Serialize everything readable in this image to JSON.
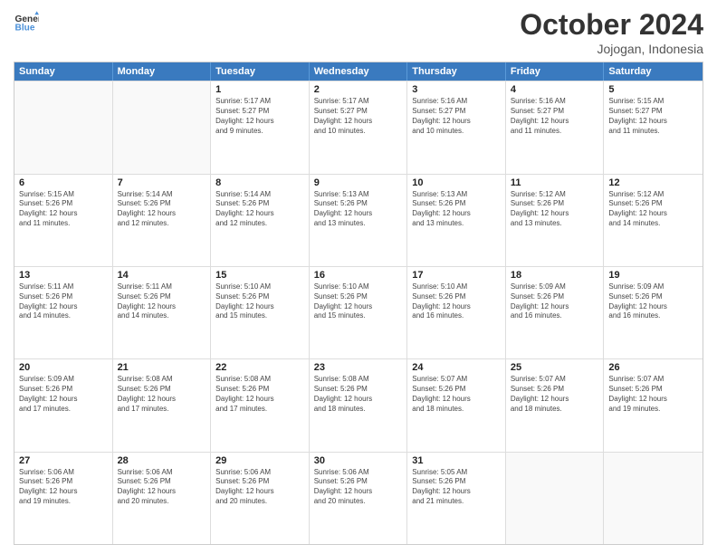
{
  "header": {
    "logo_line1": "General",
    "logo_line2": "Blue",
    "month": "October 2024",
    "location": "Jojogan, Indonesia"
  },
  "weekdays": [
    "Sunday",
    "Monday",
    "Tuesday",
    "Wednesday",
    "Thursday",
    "Friday",
    "Saturday"
  ],
  "rows": [
    [
      {
        "day": "",
        "info": ""
      },
      {
        "day": "",
        "info": ""
      },
      {
        "day": "1",
        "info": "Sunrise: 5:17 AM\nSunset: 5:27 PM\nDaylight: 12 hours\nand 9 minutes."
      },
      {
        "day": "2",
        "info": "Sunrise: 5:17 AM\nSunset: 5:27 PM\nDaylight: 12 hours\nand 10 minutes."
      },
      {
        "day": "3",
        "info": "Sunrise: 5:16 AM\nSunset: 5:27 PM\nDaylight: 12 hours\nand 10 minutes."
      },
      {
        "day": "4",
        "info": "Sunrise: 5:16 AM\nSunset: 5:27 PM\nDaylight: 12 hours\nand 11 minutes."
      },
      {
        "day": "5",
        "info": "Sunrise: 5:15 AM\nSunset: 5:27 PM\nDaylight: 12 hours\nand 11 minutes."
      }
    ],
    [
      {
        "day": "6",
        "info": "Sunrise: 5:15 AM\nSunset: 5:26 PM\nDaylight: 12 hours\nand 11 minutes."
      },
      {
        "day": "7",
        "info": "Sunrise: 5:14 AM\nSunset: 5:26 PM\nDaylight: 12 hours\nand 12 minutes."
      },
      {
        "day": "8",
        "info": "Sunrise: 5:14 AM\nSunset: 5:26 PM\nDaylight: 12 hours\nand 12 minutes."
      },
      {
        "day": "9",
        "info": "Sunrise: 5:13 AM\nSunset: 5:26 PM\nDaylight: 12 hours\nand 13 minutes."
      },
      {
        "day": "10",
        "info": "Sunrise: 5:13 AM\nSunset: 5:26 PM\nDaylight: 12 hours\nand 13 minutes."
      },
      {
        "day": "11",
        "info": "Sunrise: 5:12 AM\nSunset: 5:26 PM\nDaylight: 12 hours\nand 13 minutes."
      },
      {
        "day": "12",
        "info": "Sunrise: 5:12 AM\nSunset: 5:26 PM\nDaylight: 12 hours\nand 14 minutes."
      }
    ],
    [
      {
        "day": "13",
        "info": "Sunrise: 5:11 AM\nSunset: 5:26 PM\nDaylight: 12 hours\nand 14 minutes."
      },
      {
        "day": "14",
        "info": "Sunrise: 5:11 AM\nSunset: 5:26 PM\nDaylight: 12 hours\nand 14 minutes."
      },
      {
        "day": "15",
        "info": "Sunrise: 5:10 AM\nSunset: 5:26 PM\nDaylight: 12 hours\nand 15 minutes."
      },
      {
        "day": "16",
        "info": "Sunrise: 5:10 AM\nSunset: 5:26 PM\nDaylight: 12 hours\nand 15 minutes."
      },
      {
        "day": "17",
        "info": "Sunrise: 5:10 AM\nSunset: 5:26 PM\nDaylight: 12 hours\nand 16 minutes."
      },
      {
        "day": "18",
        "info": "Sunrise: 5:09 AM\nSunset: 5:26 PM\nDaylight: 12 hours\nand 16 minutes."
      },
      {
        "day": "19",
        "info": "Sunrise: 5:09 AM\nSunset: 5:26 PM\nDaylight: 12 hours\nand 16 minutes."
      }
    ],
    [
      {
        "day": "20",
        "info": "Sunrise: 5:09 AM\nSunset: 5:26 PM\nDaylight: 12 hours\nand 17 minutes."
      },
      {
        "day": "21",
        "info": "Sunrise: 5:08 AM\nSunset: 5:26 PM\nDaylight: 12 hours\nand 17 minutes."
      },
      {
        "day": "22",
        "info": "Sunrise: 5:08 AM\nSunset: 5:26 PM\nDaylight: 12 hours\nand 17 minutes."
      },
      {
        "day": "23",
        "info": "Sunrise: 5:08 AM\nSunset: 5:26 PM\nDaylight: 12 hours\nand 18 minutes."
      },
      {
        "day": "24",
        "info": "Sunrise: 5:07 AM\nSunset: 5:26 PM\nDaylight: 12 hours\nand 18 minutes."
      },
      {
        "day": "25",
        "info": "Sunrise: 5:07 AM\nSunset: 5:26 PM\nDaylight: 12 hours\nand 18 minutes."
      },
      {
        "day": "26",
        "info": "Sunrise: 5:07 AM\nSunset: 5:26 PM\nDaylight: 12 hours\nand 19 minutes."
      }
    ],
    [
      {
        "day": "27",
        "info": "Sunrise: 5:06 AM\nSunset: 5:26 PM\nDaylight: 12 hours\nand 19 minutes."
      },
      {
        "day": "28",
        "info": "Sunrise: 5:06 AM\nSunset: 5:26 PM\nDaylight: 12 hours\nand 20 minutes."
      },
      {
        "day": "29",
        "info": "Sunrise: 5:06 AM\nSunset: 5:26 PM\nDaylight: 12 hours\nand 20 minutes."
      },
      {
        "day": "30",
        "info": "Sunrise: 5:06 AM\nSunset: 5:26 PM\nDaylight: 12 hours\nand 20 minutes."
      },
      {
        "day": "31",
        "info": "Sunrise: 5:05 AM\nSunset: 5:26 PM\nDaylight: 12 hours\nand 21 minutes."
      },
      {
        "day": "",
        "info": ""
      },
      {
        "day": "",
        "info": ""
      }
    ]
  ]
}
